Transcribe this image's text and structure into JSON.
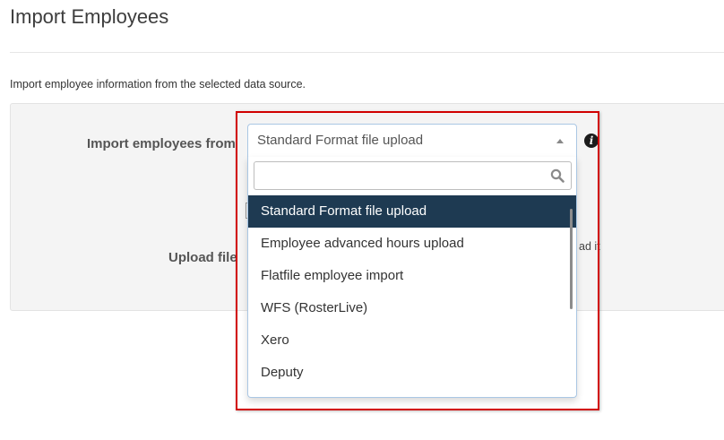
{
  "page": {
    "title": "Import Employees",
    "description": "Import employee information from the selected data source."
  },
  "form": {
    "import_from_label": "Import employees from",
    "upload_file_label": "Upload file",
    "obscured_text_fragment": "ad it"
  },
  "select": {
    "selected_value": "Standard Format file upload",
    "search_value": "",
    "search_placeholder": "",
    "options": [
      "Standard Format file upload",
      "Employee advanced hours upload",
      "Flatfile employee import",
      "WFS (RosterLive)",
      "Xero",
      "Deputy"
    ],
    "highlighted_index": 0
  },
  "icons": {
    "info": "info-icon",
    "search": "search-icon",
    "dropdown_arrow": "caret-up-icon"
  },
  "info_icon_glyph": "i",
  "colors": {
    "highlight_bg": "#1e3a52",
    "annotation_border": "#d10000",
    "select_border": "#aac7e4",
    "panel_bg": "#f4f4f4"
  }
}
